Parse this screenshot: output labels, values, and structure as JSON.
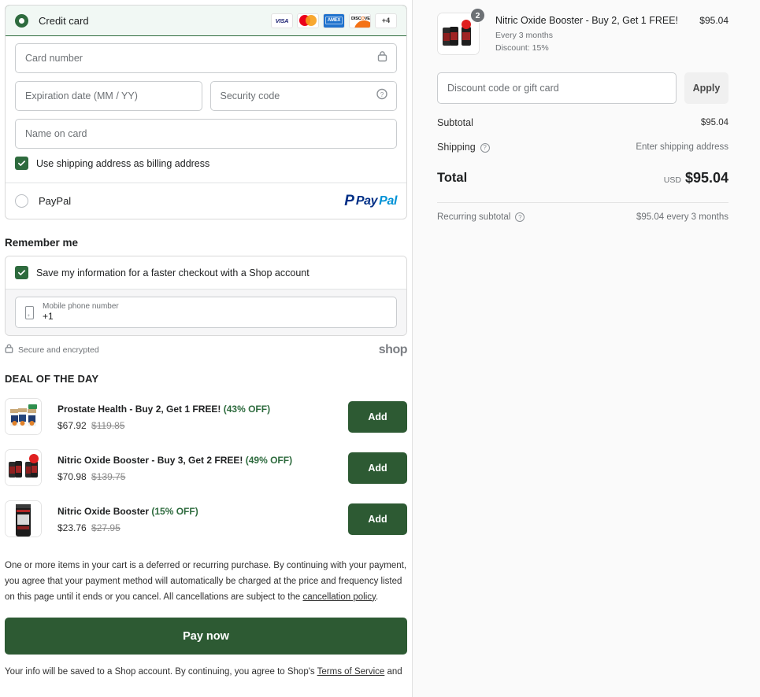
{
  "payment": {
    "credit_card": {
      "label": "Credit card",
      "selected": true,
      "brands": [
        "VISA",
        "Mastercard",
        "AMEX",
        "DISCOVER",
        "+4"
      ],
      "more_brands_label": "+4",
      "fields": {
        "card_number": {
          "placeholder": "Card number",
          "value": "",
          "icon": "lock-icon"
        },
        "expiration": {
          "placeholder": "Expiration date (MM / YY)",
          "value": ""
        },
        "security_code": {
          "placeholder": "Security code",
          "value": "",
          "icon": "question-mark-icon"
        },
        "name_on_card": {
          "placeholder": "Name on card",
          "value": ""
        }
      },
      "billing_checkbox": {
        "label": "Use shipping address as billing address",
        "checked": true
      }
    },
    "paypal": {
      "label": "PayPal",
      "selected": false,
      "logo_pay": "Pay",
      "logo_pal": "Pal",
      "logo_mark": "P"
    }
  },
  "remember_me": {
    "title": "Remember me",
    "save_checkbox": {
      "label": "Save my information for a faster checkout with a Shop account",
      "checked": true
    },
    "phone": {
      "label": "Mobile phone number",
      "value": "+1"
    },
    "secure_text": "Secure and encrypted",
    "shop_logo": "shop"
  },
  "deal_of_the_day": {
    "title": "DEAL OF THE DAY",
    "add_label": "Add",
    "items": [
      {
        "name": "Prostate Health - Buy 2, Get 1 FREE!",
        "discount": "(43% OFF)",
        "price": "$67.92",
        "compare_price": "$119.85"
      },
      {
        "name": "Nitric Oxide Booster - Buy 3, Get 2 FREE!",
        "discount": "(49% OFF)",
        "price": "$70.98",
        "compare_price": "$139.75"
      },
      {
        "name": "Nitric Oxide Booster",
        "discount": "(15% OFF)",
        "price": "$23.76",
        "compare_price": "$27.95"
      }
    ]
  },
  "legal": {
    "recurring_notice_part1": "One or more items in your cart is a deferred or recurring purchase. By continuing with your payment, you agree that your payment method will automatically be charged at the price and frequency listed on this page until it ends or you cancel. All cancellations are subject to the ",
    "cancellation_link": "cancellation policy",
    "recurring_notice_part2": ".",
    "pay_now_label": "Pay now",
    "footnote_part1": "Your info will be saved to a Shop account. By continuing, you agree to Shop's ",
    "footnote_link": "Terms of Service",
    "footnote_part2": " and"
  },
  "order_summary": {
    "item": {
      "name": "Nitric Oxide Booster - Buy 2, Get 1 FREE!",
      "frequency": "Every 3 months",
      "discount_line": "Discount: 15%",
      "price": "$95.04",
      "quantity": "2"
    },
    "discount_field": {
      "placeholder": "Discount code or gift card",
      "value": ""
    },
    "apply_label": "Apply",
    "subtotal": {
      "label": "Subtotal",
      "value": "$95.04"
    },
    "shipping": {
      "label": "Shipping",
      "value": "Enter shipping address",
      "icon": "question-mark-icon"
    },
    "total": {
      "label": "Total",
      "currency": "USD",
      "value": "$95.04"
    },
    "recurring_subtotal": {
      "label": "Recurring subtotal",
      "value": "$95.04 every 3 months",
      "icon": "question-mark-icon"
    }
  },
  "colors": {
    "brand_green": "#2d5a33",
    "accent_green": "#2e6b3e",
    "panel_bg": "#fafafa"
  }
}
